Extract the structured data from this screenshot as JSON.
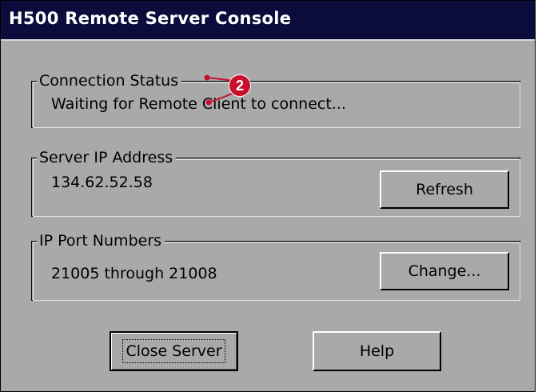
{
  "window": {
    "title": "H500 Remote Server Console"
  },
  "connection_status": {
    "label": "Connection Status",
    "value": "Waiting for Remote Client to connect..."
  },
  "server_ip": {
    "label": "Server IP Address",
    "value": "134.62.52.58",
    "refresh_label": "Refresh"
  },
  "ports": {
    "label": "IP Port Numbers",
    "value": "21005 through 21008",
    "change_label": "Change..."
  },
  "footer": {
    "close_label": "Close Server",
    "help_label": "Help"
  },
  "annotation": {
    "callout_number": "2",
    "callout_color": "#c8102e"
  },
  "colors": {
    "titlebar": "#0b0c3c",
    "window_bg": "#a9a9a9"
  }
}
